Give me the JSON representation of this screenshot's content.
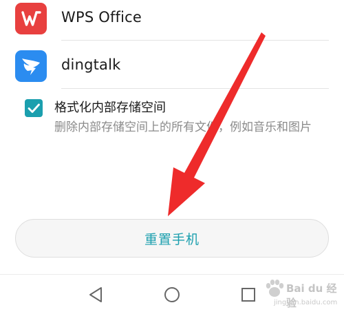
{
  "apps": [
    {
      "name": "WPS Office",
      "icon": "wps-office-icon",
      "color": "#e8403f"
    },
    {
      "name": "dingtalk",
      "icon": "dingtalk-icon",
      "color": "#2b8cf0"
    }
  ],
  "option": {
    "checked": true,
    "title": "格式化内部存储空间",
    "description": "删除内部存储空间上的所有文件，例如音乐和图片"
  },
  "reset_button": {
    "label": "重置手机"
  },
  "navbar": {
    "back": "back-triangle-icon",
    "home": "home-circle-icon",
    "recent": "recent-square-icon"
  },
  "annotation": {
    "arrow": "red-arrow-icon",
    "color": "#ee2b2b"
  },
  "watermark": {
    "main": "Bai du 经验",
    "sub": "jingyan.baidu.com"
  },
  "colors": {
    "accent": "#1b9fae",
    "divider": "#e3e3e3",
    "secondary_text": "#8a8a8a"
  }
}
